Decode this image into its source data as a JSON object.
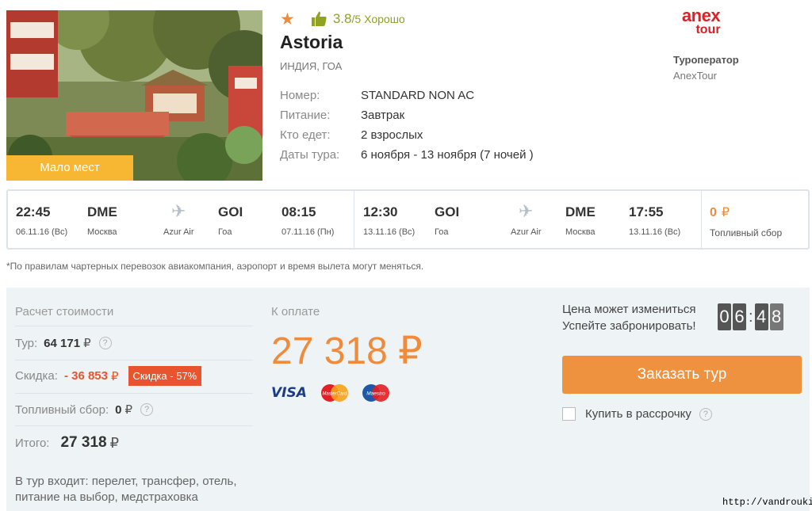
{
  "hotel": {
    "badge": "Мало мест",
    "stars": "★",
    "rating_score": "3.8",
    "rating_max": "/5",
    "rating_text": "Хорошо",
    "name": "Astoria",
    "location": "ИНДИЯ, ГОА",
    "details": [
      {
        "label": "Номер:",
        "value": "STANDARD NON AC"
      },
      {
        "label": "Питание:",
        "value": "Завтрак"
      },
      {
        "label": "Кто едет:",
        "value": "2 взрослых"
      },
      {
        "label": "Даты тура:",
        "value": "6 ноября - 13 ноября (7 ночей )"
      }
    ]
  },
  "operator": {
    "logo_line1": "anex",
    "logo_line2": "tour",
    "label": "Туроператор",
    "name": "AnexTour"
  },
  "flights": {
    "outbound": {
      "dep_time": "22:45",
      "dep_date": "06.11.16 (Вс)",
      "dep_code": "DME",
      "dep_city": "Москва",
      "airline": "Azur Air",
      "arr_code": "GOI",
      "arr_city": "Гоа",
      "arr_time": "08:15",
      "arr_date": "07.11.16 (Пн)"
    },
    "return": {
      "dep_time": "12:30",
      "dep_date": "13.11.16 (Вс)",
      "dep_code": "GOI",
      "dep_city": "Гоа",
      "airline": "Azur Air",
      "arr_code": "DME",
      "arr_city": "Москва",
      "arr_time": "17:55",
      "arr_date": "13.11.16 (Вс)"
    },
    "fuel_amount": "0",
    "fuel_currency": "₽",
    "fuel_label": "Топливный сбор"
  },
  "disclaimer": "*По правилам чартерных перевозок авиакомпания, аэропорт и время вылета могут меняться.",
  "calc": {
    "title": "Расчет стоимости",
    "tour_label": "Тур:",
    "tour_value": "64 171",
    "discount_label": "Скидка:",
    "discount_value": "- 36 853",
    "discount_badge": "Скидка - 57%",
    "fuel_label": "Топливный сбор:",
    "fuel_value": "0",
    "total_label": "Итого:",
    "total_value": "27 318",
    "currency": "₽",
    "help": "?",
    "includes": "В тур входит: перелет, трансфер, отель, питание на выбор, медстраховка"
  },
  "payment": {
    "title": "К оплате",
    "amount": "27 318 ₽",
    "card_visa": "VISA",
    "card_mastercard": "MasterCard",
    "card_maestro": "Maestro"
  },
  "booking": {
    "warn_line1": "Цена может измениться",
    "warn_line2": "Успейте забронировать!",
    "timer_digits": [
      "0",
      "6",
      "4",
      "8"
    ],
    "timer_sep": ":",
    "order_button": "Заказать тур",
    "installment_label": "Купить в рассрочку"
  },
  "watermark": "http://vandrouki.ru/",
  "colors": {
    "accent_orange": "#ef8b3a",
    "rating_green": "#8fa321",
    "discount_red": "#e8542d",
    "badge_yellow": "#f7b733",
    "panel_bg": "#eef3f6"
  }
}
